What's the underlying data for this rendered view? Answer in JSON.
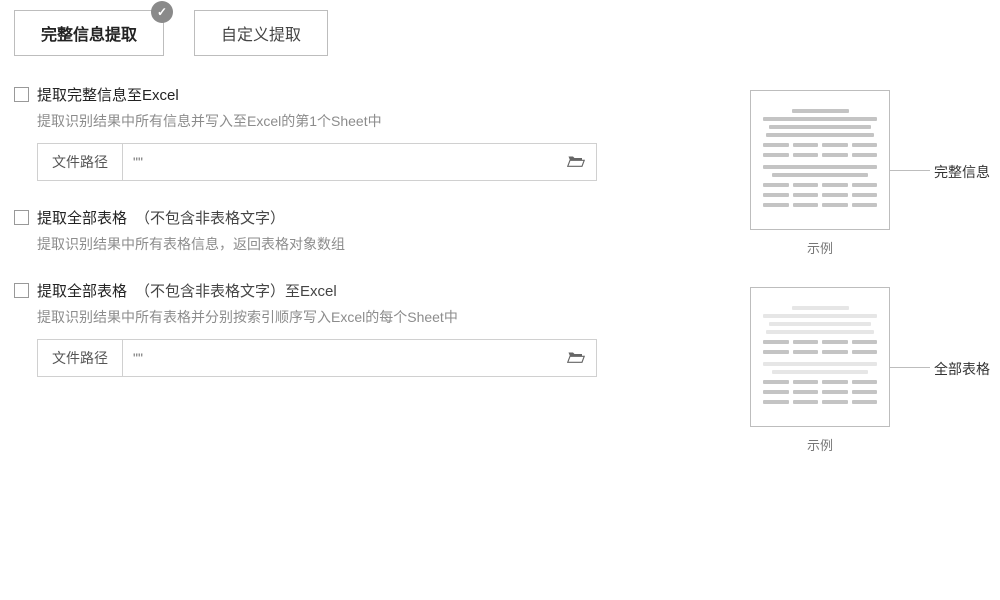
{
  "tabs": {
    "full": "完整信息提取",
    "custom": "自定义提取"
  },
  "options": {
    "excel_full": {
      "title": "提取完整信息至Excel",
      "desc": "提取识别结果中所有信息并写入至Excel的第1个Sheet中",
      "path_label": "文件路径",
      "path_placeholder": "\"\""
    },
    "tables_only": {
      "title": "提取全部表格",
      "title_hint": "（不包含非表格文字）",
      "desc": "提取识别结果中所有表格信息，返回表格对象数组"
    },
    "tables_excel": {
      "title": "提取全部表格",
      "title_hint": "（不包含非表格文字）至Excel",
      "desc": "提取识别结果中所有表格并分别按索引顺序写入Excel的每个Sheet中",
      "path_label": "文件路径",
      "path_placeholder": "\"\""
    }
  },
  "examples": {
    "caption": "示例",
    "full_label": "完整信息",
    "tables_label": "全部表格"
  }
}
